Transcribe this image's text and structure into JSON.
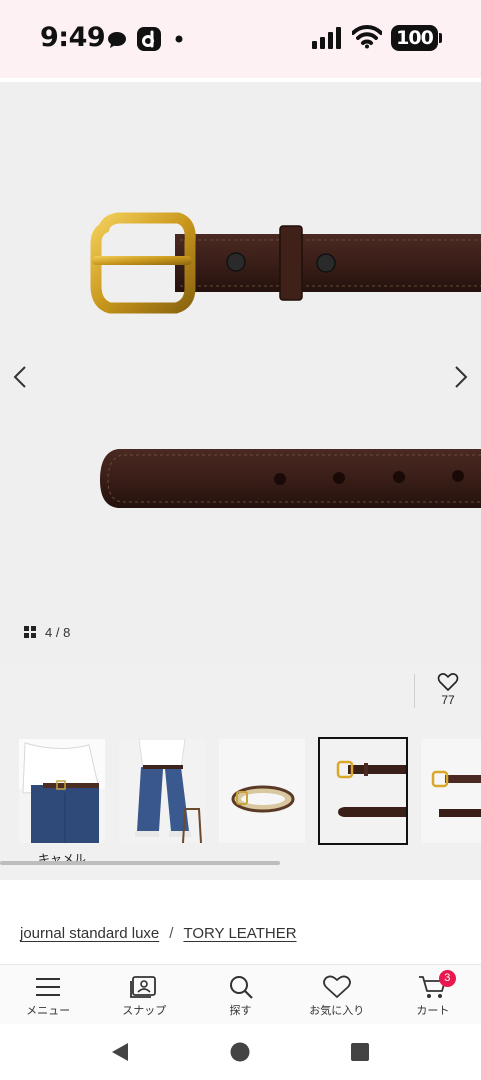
{
  "status_bar": {
    "time": "9:49",
    "battery": "100",
    "icons": [
      "chat-bubble-icon",
      "d-app-icon",
      "dot-icon",
      "signal-icon",
      "wifi-icon",
      "battery-icon"
    ]
  },
  "gallery": {
    "counter": "4 / 8",
    "icons": [
      "prev-arrow-icon",
      "next-arrow-icon",
      "grid-icon"
    ]
  },
  "favorite": {
    "count": "77",
    "icon": "heart-icon"
  },
  "thumbnails": {
    "items": [
      {
        "icon": "thumbnail-model-front"
      },
      {
        "icon": "thumbnail-model-side"
      },
      {
        "icon": "thumbnail-belt-beige"
      },
      {
        "icon": "thumbnail-belt-brown",
        "selected": true
      },
      {
        "icon": "thumbnail-belt-brown-2"
      }
    ],
    "first_label": "キャメル"
  },
  "breadcrumb": {
    "brand": "journal standard luxe",
    "separator": "/",
    "maker": "TORY LEATHER"
  },
  "tabbar": {
    "items": [
      {
        "label": "メニュー",
        "icon": "menu-icon"
      },
      {
        "label": "スナップ",
        "icon": "snap-icon"
      },
      {
        "label": "探す",
        "icon": "search-icon"
      },
      {
        "label": "お気に入り",
        "icon": "heart-icon"
      },
      {
        "label": "カート",
        "icon": "cart-icon"
      }
    ],
    "cart_badge": "3"
  },
  "colors": {
    "status_bg": "#fdf1f4",
    "gallery_bg": "#efefef",
    "badge": "#e8194e",
    "leather": "#3b1d16",
    "brass": "#d9a82a"
  }
}
